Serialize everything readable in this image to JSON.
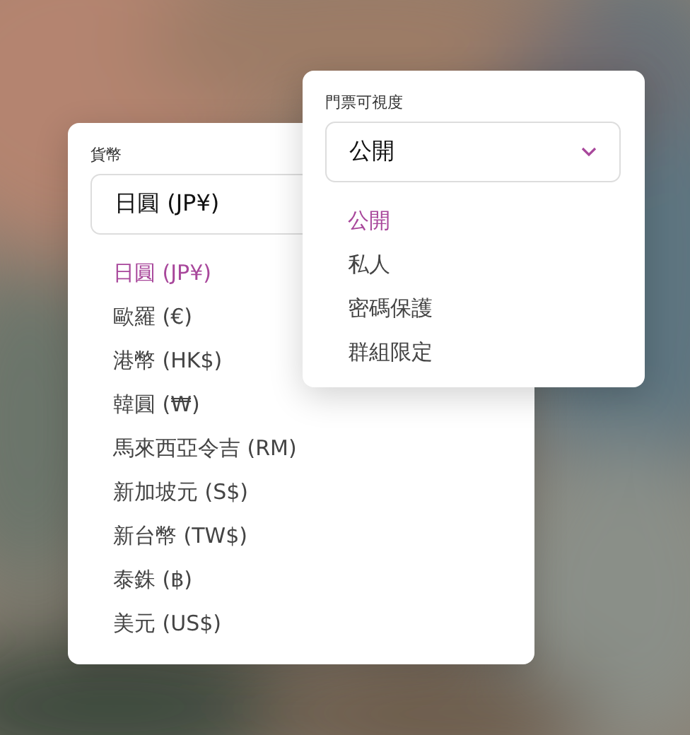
{
  "currency": {
    "label": "貨幣",
    "value": "日圓 (JP¥)",
    "options": [
      {
        "label": "日圓 (JP¥)",
        "selected": true
      },
      {
        "label": "歐羅 (€)",
        "selected": false
      },
      {
        "label": "港幣 (HK$)",
        "selected": false
      },
      {
        "label": "韓圓 (₩)",
        "selected": false
      },
      {
        "label": "馬來西亞令吉 (RM)",
        "selected": false
      },
      {
        "label": "新加坡元 (S$)",
        "selected": false
      },
      {
        "label": "新台幣 (TW$)",
        "selected": false
      },
      {
        "label": "泰銖 (฿)",
        "selected": false
      },
      {
        "label": "美元 (US$)",
        "selected": false
      }
    ]
  },
  "visibility": {
    "label": "門票可視度",
    "value": "公開",
    "options": [
      {
        "label": "公開",
        "selected": true
      },
      {
        "label": "私人",
        "selected": false
      },
      {
        "label": "密碼保護",
        "selected": false
      },
      {
        "label": "群組限定",
        "selected": false
      }
    ]
  }
}
